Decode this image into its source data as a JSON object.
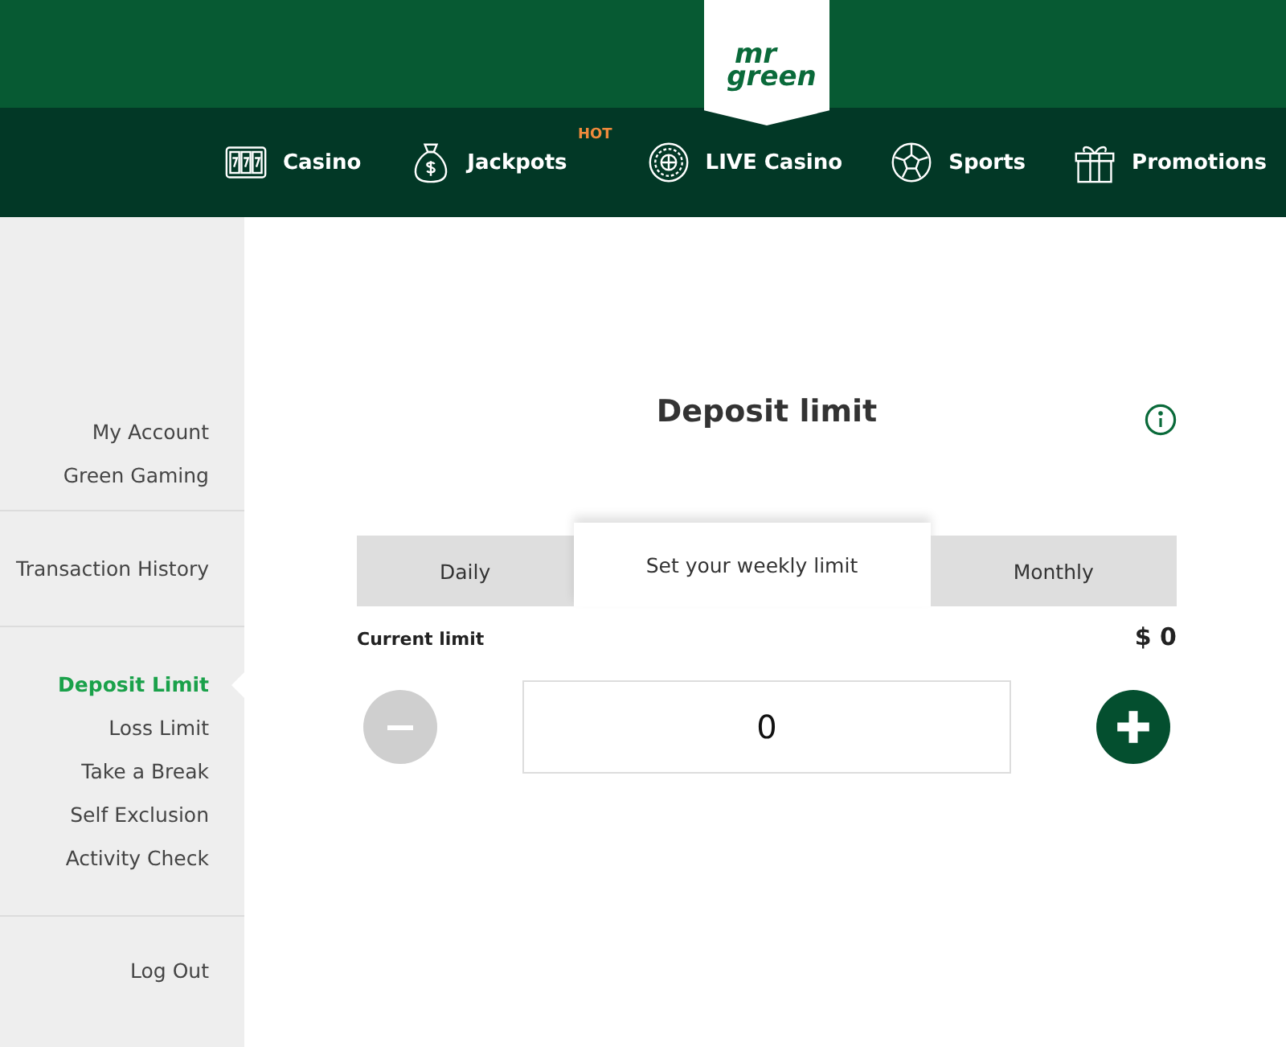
{
  "logo": {
    "line_1": "mr",
    "line_2": "green"
  },
  "nav": [
    {
      "kind": "slots",
      "label": "Casino"
    },
    {
      "kind": "bag",
      "label": "Jackpots",
      "badge": "HOT"
    },
    {
      "kind": "roulette",
      "label": "LIVE Casino"
    },
    {
      "kind": "ball",
      "label": "Sports"
    },
    {
      "kind": "gift",
      "label": "Promotions"
    }
  ],
  "sidebar": {
    "groups": [
      {
        "items": [
          {
            "label": "My Account",
            "selected": false
          },
          {
            "label": "Green Gaming",
            "selected": false
          }
        ]
      },
      {
        "items": [
          {
            "label": "Transaction History",
            "selected": false
          }
        ]
      },
      {
        "items": [
          {
            "label": "Deposit Limit",
            "selected": true
          },
          {
            "label": "Loss Limit",
            "selected": false
          },
          {
            "label": "Take a Break",
            "selected": false
          },
          {
            "label": "Self Exclusion",
            "selected": false
          },
          {
            "label": "Activity Check",
            "selected": false
          }
        ]
      },
      {
        "items": [
          {
            "label": "Log Out",
            "selected": false
          }
        ]
      }
    ]
  },
  "title": "Deposit limit",
  "tabs": [
    {
      "label": "Daily",
      "selected": false
    },
    {
      "label": "Set your weekly limit",
      "selected": true
    },
    {
      "label": "Monthly",
      "selected": false
    }
  ],
  "current_limit": {
    "label": "Current limit",
    "value": "$ 0"
  },
  "amount": {
    "value": "0",
    "decrease_disabled": true,
    "increase_disabled": false
  }
}
